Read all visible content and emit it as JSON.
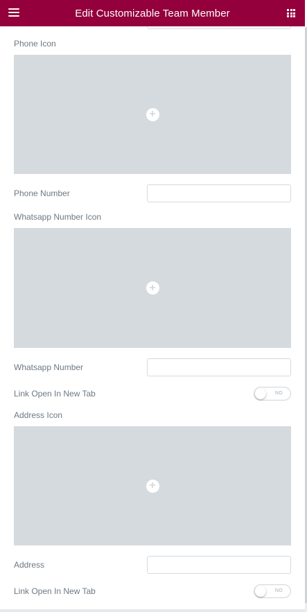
{
  "header": {
    "title": "Edit Customizable Team Member",
    "menu_icon": "hamburger-menu-icon",
    "apps_icon": "grid-apps-icon",
    "background_color": "#93003c"
  },
  "fields": {
    "phone_icon": {
      "label": "Phone Icon",
      "action_icon": "plus-icon"
    },
    "phone_number": {
      "label": "Phone Number",
      "value": ""
    },
    "whatsapp_icon": {
      "label": "Whatsapp Number Icon",
      "action_icon": "plus-icon"
    },
    "whatsapp_number": {
      "label": "Whatsapp Number",
      "value": ""
    },
    "whatsapp_new_tab": {
      "label": "Link Open In New Tab",
      "state": "NO"
    },
    "address_icon": {
      "label": "Address Icon",
      "action_icon": "plus-icon"
    },
    "address": {
      "label": "Address",
      "value": ""
    },
    "address_new_tab": {
      "label": "Link Open In New Tab",
      "state": "NO"
    }
  },
  "colors": {
    "media_placeholder": "#d5dadf",
    "label_text": "#6d7882"
  }
}
